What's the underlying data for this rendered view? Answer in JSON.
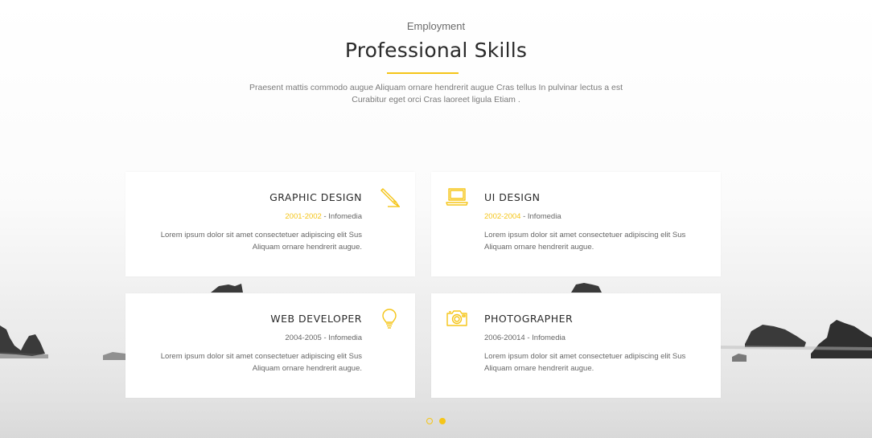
{
  "section": {
    "eyebrow": "Employment",
    "title": "Professional Skills",
    "intro": "Praesent mattis commodo augue Aliquam ornare hendrerit augue Cras tellus In pulvinar lectus a est Curabitur eget orci Cras laoreet ligula Etiam ."
  },
  "cards": [
    {
      "title": "GRAPHIC DESIGN",
      "years": "2001-2002",
      "company": " - Infomedia",
      "desc": "Lorem ipsum dolor sit amet consectetuer adipiscing elit Sus Aliquam ornare hendrerit augue.",
      "icon": "pencil-icon"
    },
    {
      "title": "UI DESIGN",
      "years": "2002-2004",
      "company": " - Infomedia",
      "desc": "Lorem ipsum dolor sit amet consectetuer adipiscing elit Sus Aliquam ornare hendrerit augue.",
      "icon": "laptop-icon"
    },
    {
      "title": "WEB DEVELOPER",
      "years": "2004-2005",
      "company": " - Infomedia",
      "desc": "Lorem ipsum dolor sit amet consectetuer adipiscing elit Sus Aliquam ornare hendrerit augue.",
      "icon": "lightbulb-icon"
    },
    {
      "title": "PHOTOGRAPHER",
      "years": "2006-20014",
      "company": " - Infomedia",
      "desc": "Lorem ipsum dolor sit amet consectetuer adipiscing elit Sus Aliquam ornare hendrerit augue.",
      "icon": "camera-icon"
    }
  ],
  "pagination": {
    "pages": 2,
    "active": 2
  },
  "colors": {
    "accent": "#f5c518",
    "text": "#2b2b2b",
    "muted": "#666666"
  }
}
